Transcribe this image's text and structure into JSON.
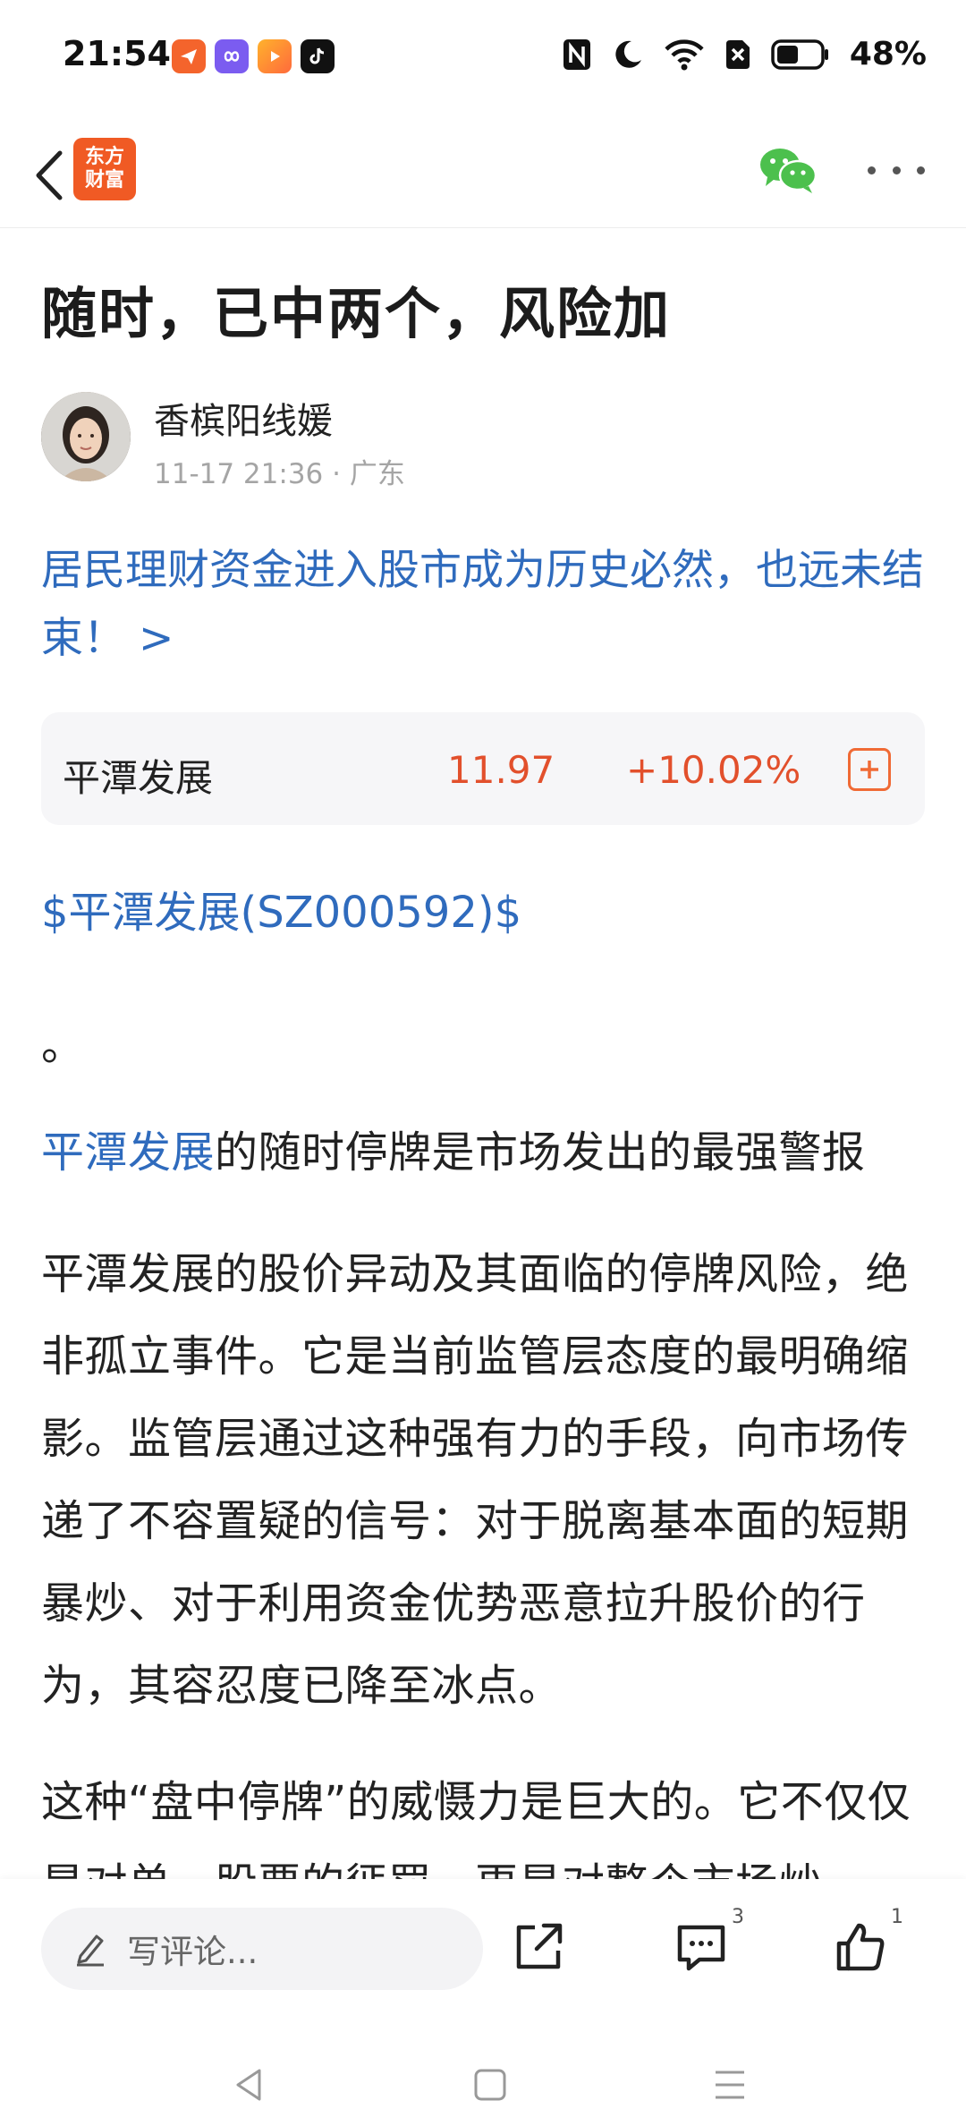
{
  "status_bar": {
    "time": "21:54",
    "battery": "48%",
    "icons": [
      "send-app-icon",
      "infinity-app-icon",
      "video-app-icon",
      "tiktok-app-icon",
      "nfc-icon",
      "moon-icon",
      "wifi-icon",
      "sim-off-icon",
      "battery-icon"
    ]
  },
  "nav": {
    "logo_line1": "东方",
    "logo_line2": "财富",
    "brand_color": "#f05a24"
  },
  "article": {
    "title": "随时，已中两个，风险加",
    "author": "香槟阳线媛",
    "timestamp": "11-17 21:36",
    "location": "· 广东",
    "promo_link": "居民理财资金进入股市成为历史必然，也远未结束！ >",
    "stock_card": {
      "name": "平潭发展",
      "price": "11.97",
      "change": "+10.02%",
      "up_color": "#e2502c"
    },
    "stock_tag": "$平潭发展(SZ000592)$",
    "period": "。",
    "para1_link": "平潭发展",
    "para1_rest": "的随时停牌是市场发出的最强警报",
    "para2": "平潭发展的股价异动及其面临的停牌风险，绝非孤立事件。它是当前监管层态度的最明确缩影。监管层通过这种强有力的手段，向市场传递了不容置疑的信号：对于脱离基本面的短期暴炒、对于利用资金优势恶意拉升股价的行为，其容忍度已降至冰点。",
    "para3": "这种“盘中停牌”的威慑力是巨大的。它不仅仅是对单一股票的惩罚，更是对整个市场炒"
  },
  "bottom": {
    "comment_placeholder": "写评论...",
    "comment_count": "3",
    "like_count": "1"
  },
  "link_color": "#2f6bbd"
}
